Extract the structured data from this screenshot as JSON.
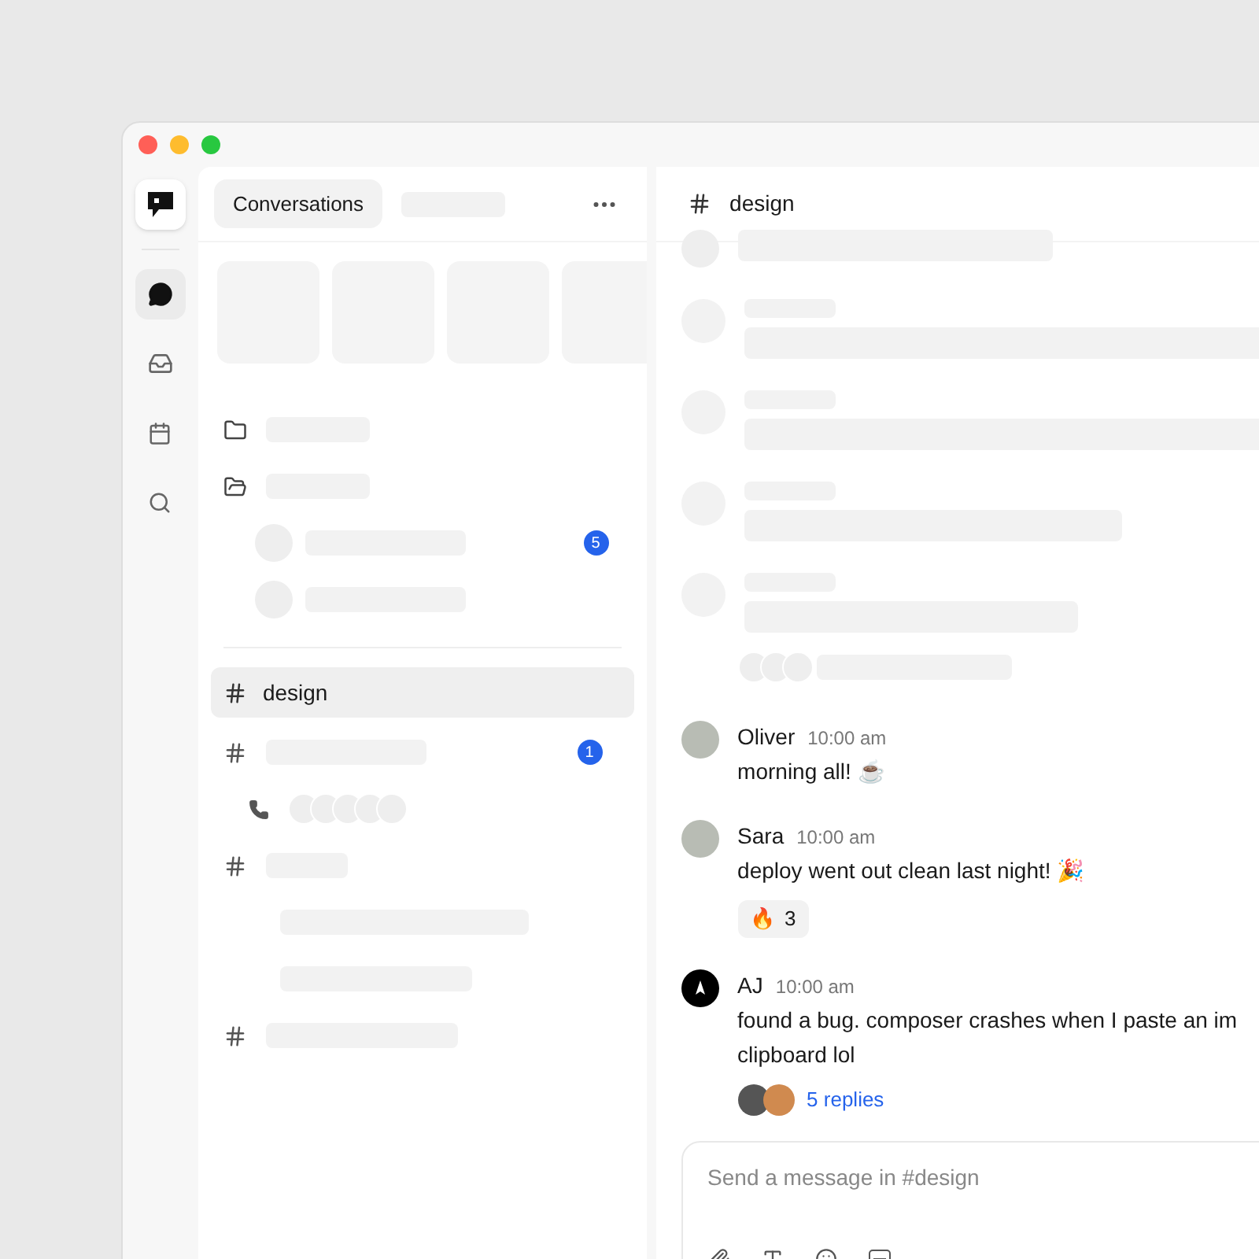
{
  "sidebar": {
    "tab": "Conversations",
    "dm_badge": "5",
    "channel": {
      "label": "design",
      "selected": true
    },
    "channel_badge": "1"
  },
  "channel_header": {
    "name": "design"
  },
  "messages": [
    {
      "author": "Oliver",
      "time": "10:00 am",
      "avatar": {
        "kind": "photo"
      },
      "lines": [
        "morning all! ☕"
      ]
    },
    {
      "author": "Sara",
      "time": "10:00 am",
      "avatar": {
        "kind": "photo"
      },
      "lines": [
        "deploy went out clean last night! 🎉"
      ],
      "reaction": {
        "emoji": "🔥",
        "count": "3"
      }
    },
    {
      "author": "AJ",
      "time": "10:00 am",
      "avatar": {
        "kind": "logo"
      },
      "lines": [
        "found a bug. composer crashes when I paste an im",
        "clipboard lol"
      ],
      "thread": {
        "replies": "5 replies"
      }
    }
  ],
  "composer": {
    "placeholder": "Send a message in #design"
  }
}
